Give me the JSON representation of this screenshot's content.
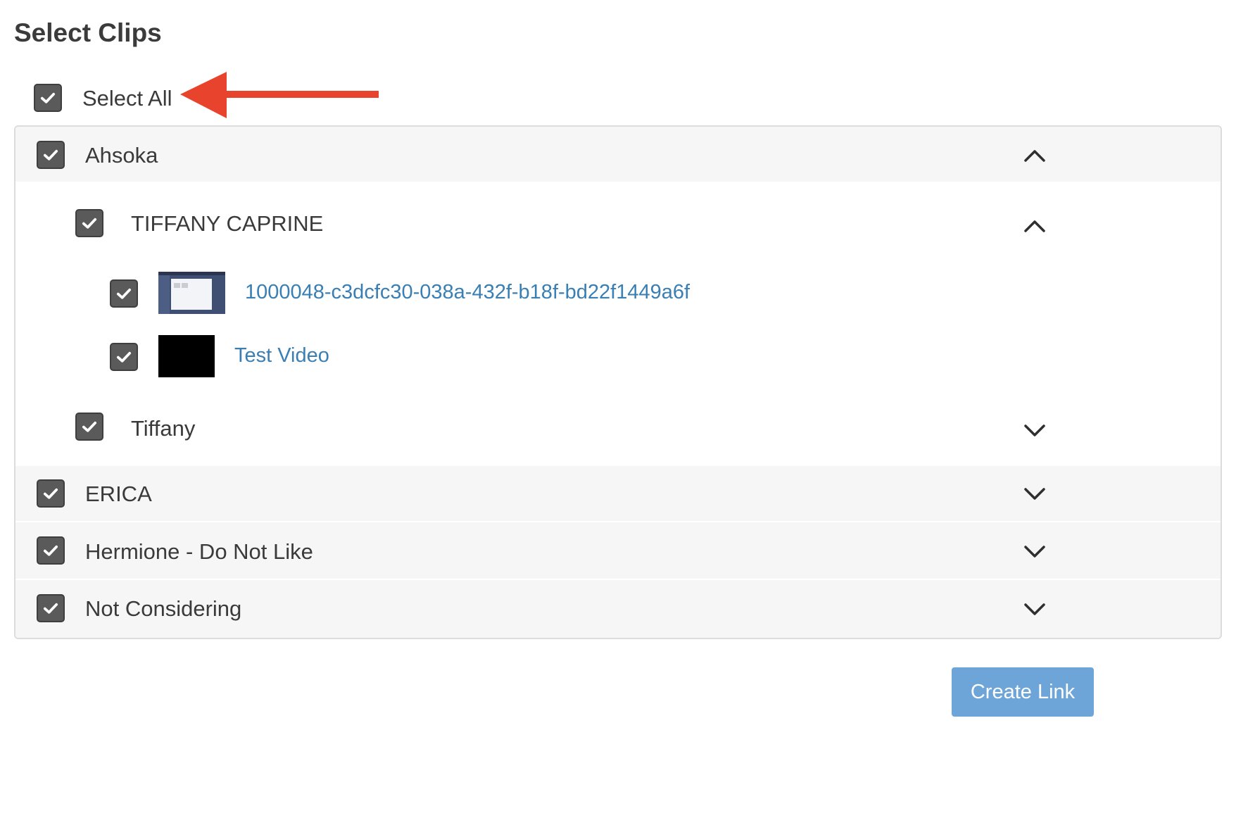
{
  "page": {
    "title": "Select Clips"
  },
  "select_all": {
    "label": "Select All",
    "checked": true
  },
  "groups": [
    {
      "label": "Ahsoka",
      "checked": true,
      "expanded": true,
      "subgroups": [
        {
          "label": "TIFFANY CAPRINE",
          "checked": true,
          "expanded": true,
          "clips": [
            {
              "label": "1000048-c3dcfc30-038a-432f-b18f-bd22f1449a6f",
              "checked": true,
              "thumbnail": "screen-capture"
            },
            {
              "label": "Test Video",
              "checked": true,
              "thumbnail": "black-frame"
            }
          ]
        },
        {
          "label": "Tiffany",
          "checked": true,
          "expanded": false
        }
      ]
    },
    {
      "label": "ERICA",
      "checked": true,
      "expanded": false
    },
    {
      "label": "Hermione - Do Not Like",
      "checked": true,
      "expanded": false
    },
    {
      "label": "Not Considering",
      "checked": true,
      "expanded": false
    }
  ],
  "actions": {
    "create_link_label": "Create Link"
  },
  "icons": {
    "checkbox": "check-icon",
    "expanded": "chevron-up-icon",
    "collapsed": "chevron-down-icon"
  },
  "colors": {
    "link": "#3a7fb3",
    "button": "#6ea5d8",
    "checkbox": "#5a5a5a",
    "annotation_arrow": "#e8442d"
  }
}
